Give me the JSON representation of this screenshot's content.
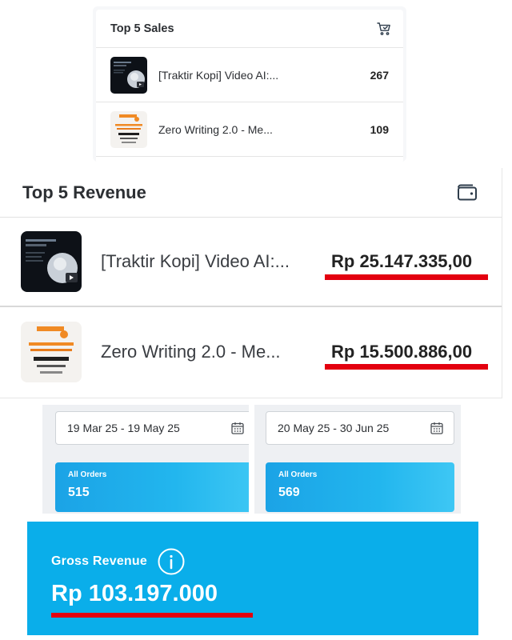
{
  "top_sales": {
    "title": "Top 5 Sales",
    "icon": "cart-icon",
    "items": [
      {
        "name": "[Traktir Kopi] Video AI:...",
        "count": "267",
        "thumb": "video-ai-thumbnail"
      },
      {
        "name": "Zero Writing 2.0 - Me...",
        "count": "109",
        "thumb": "zero-writing-thumbnail"
      }
    ]
  },
  "top_revenue": {
    "title": "Top 5 Revenue",
    "icon": "wallet-icon",
    "items": [
      {
        "name": "[Traktir Kopi] Video AI:...",
        "amount": "Rp 25.147.335,00",
        "thumb": "video-ai-thumbnail"
      },
      {
        "name": "Zero Writing 2.0 - Me...",
        "amount": "Rp 15.500.886,00",
        "thumb": "zero-writing-thumbnail"
      }
    ]
  },
  "periods": [
    {
      "date_range": "19 Mar 25 - 19 May 25",
      "orders_label": "All Orders",
      "orders_value": "515"
    },
    {
      "date_range": "20 May 25 - 30 Jun 25",
      "orders_label": "All Orders",
      "orders_value": "569"
    }
  ],
  "gross_revenue": {
    "label": "Gross Revenue",
    "value": "Rp 103.197.000",
    "icon": "info-icon"
  },
  "colors": {
    "accent_blue": "#0aaeea",
    "highlight_red": "#e3000f"
  }
}
